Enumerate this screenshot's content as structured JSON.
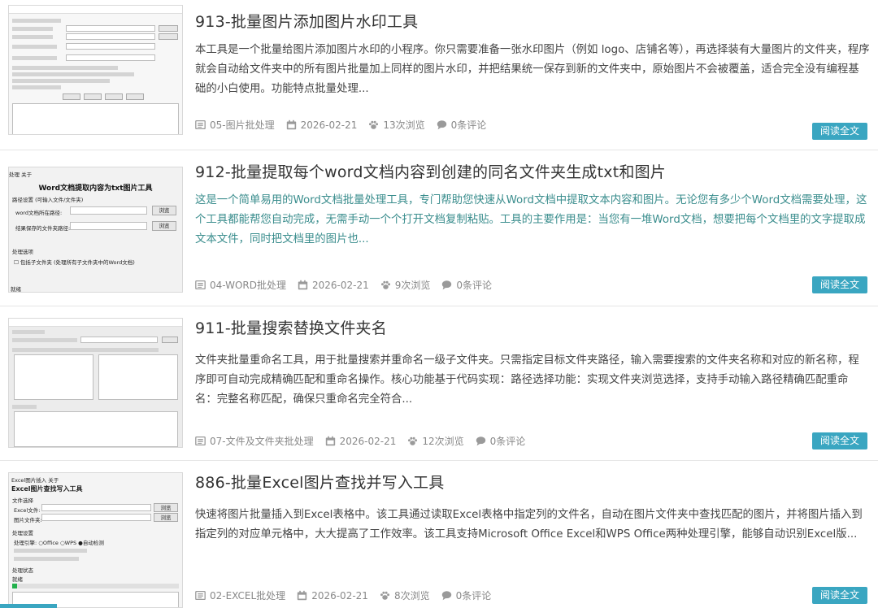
{
  "posts": [
    {
      "title": "913-批量图片添加图片水印工具",
      "excerpt": "本工具是一个批量给图片添加图片水印的小程序。你只需要准备一张水印图片（例如 logo、店铺名等），再选择装有大量图片的文件夹，程序就会自动给文件夹中的所有图片批量加上同样的图片水印，并把结果统一保存到新的文件夹中，原始图片不会被覆盖，适合完全没有编程基础的小白使用。功能特点批量处理...",
      "category": "05-图片批处理",
      "date": "2026-02-21",
      "views": "13次浏览",
      "comments": "0条评论",
      "read_label": "阅读全文"
    },
    {
      "title": "912-批量提取每个word文档内容到创建的同名文件夹生成txt和图片",
      "excerpt": "这是一个简单易用的Word文档批量处理工具，专门帮助您快速从Word文档中提取文本内容和图片。无论您有多少个Word文档需要处理，这个工具都能帮您自动完成，无需手动一个个打开文档复制粘贴。工具的主要作用是：当您有一堆Word文档，想要把每个文档里的文字提取成文本文件，同时把文档里的图片也...",
      "category": "04-WORD批处理",
      "date": "2026-02-21",
      "views": "9次浏览",
      "comments": "0条评论",
      "read_label": "阅读全文",
      "thumb": {
        "menu": "处理   关于",
        "heading": "Word文档提取内容为txt图片工具",
        "section": "路径设置 (可输入文件/文件夹)",
        "field1": "word文档所在路径:",
        "field2": "结果保存的文件夹路径:",
        "browse": "浏览",
        "options": "处理选项",
        "checkbox": "☐ 包括子文件夹 (处理所有子文件夹中的Word文档)",
        "status": "就绪"
      }
    },
    {
      "title": "911-批量搜索替换文件夹名",
      "excerpt": "文件夹批量重命名工具，用于批量搜索并重命名一级子文件夹。只需指定目标文件夹路径，输入需要搜索的文件夹名称和对应的新名称，程序即可自动完成精确匹配和重命名操作。核心功能基于代码实现：路径选择功能：实现文件夹浏览选择，支持手动输入路径精确匹配重命名：完整名称匹配，确保只重命名完全符合...",
      "category": "07-文件及文件夹批处理",
      "date": "2026-02-21",
      "views": "12次浏览",
      "comments": "0条评论",
      "read_label": "阅读全文"
    },
    {
      "title": "886-批量Excel图片查找并写入工具",
      "excerpt": "快速将图片批量插入到Excel表格中。该工具通过读取Excel表格中指定列的文件名，自动在图片文件夹中查找匹配的图片，并将图片插入到指定列的对应单元格中，大大提高了工作效率。该工具支持Microsoft Office Excel和WPS Office两种处理引擎，能够自动识别Excel版...",
      "category": "02-EXCEL批处理",
      "date": "2026-02-21",
      "views": "8次浏览",
      "comments": "0条评论",
      "read_label": "阅读全文",
      "thumb": {
        "menu": "Excel图片插入   关于",
        "heading": "Excel图片查找写入工具",
        "section": "文件选择",
        "field1": "Excel文件:",
        "field2": "图片文件夹:",
        "browse": "浏览",
        "options": "处理设置",
        "engine": "处理引擎: ○Office ○WPS ●自动检测",
        "log": "处理状态",
        "status": "就绪"
      }
    }
  ]
}
